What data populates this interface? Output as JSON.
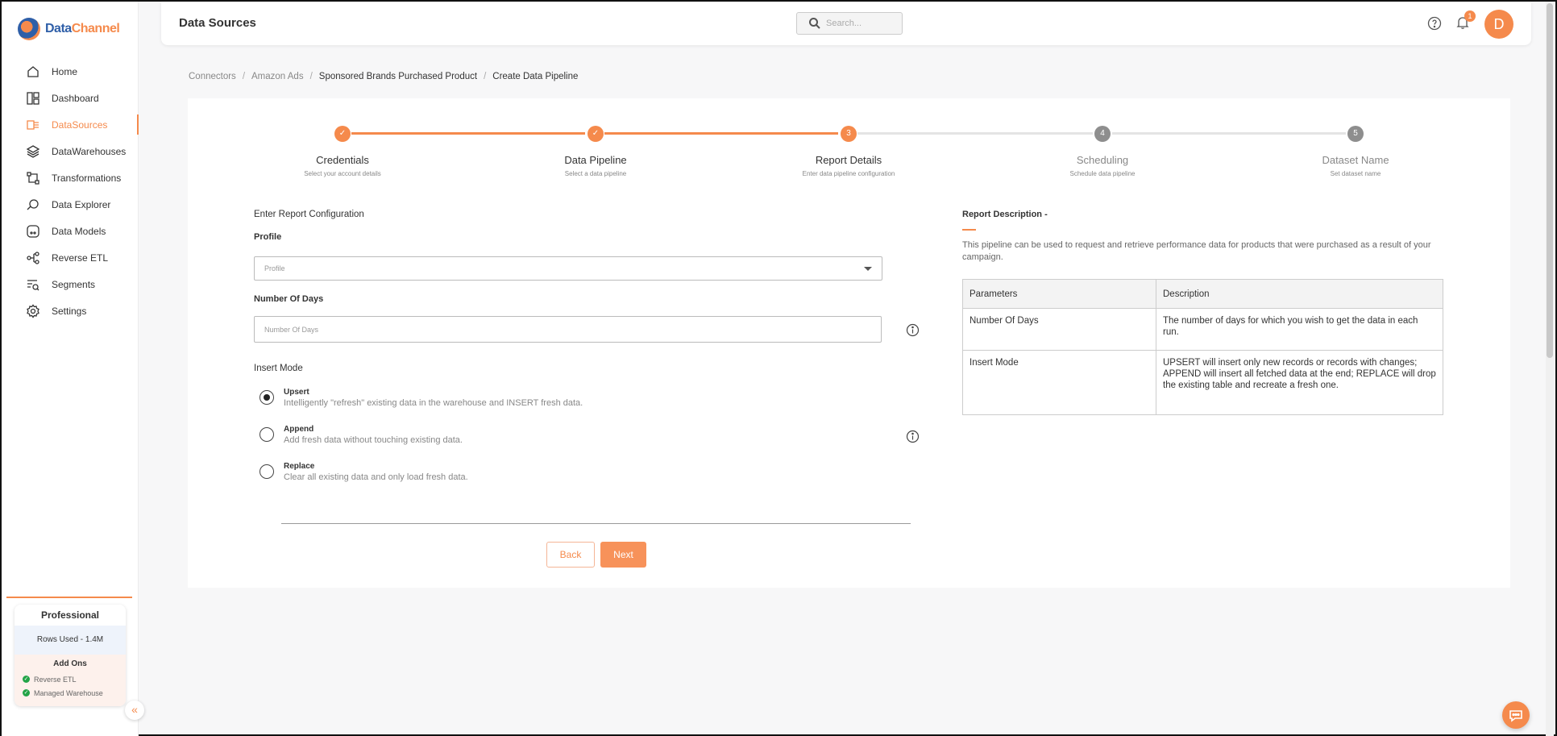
{
  "brand": {
    "name_part1": "Data",
    "name_part2": "Channel"
  },
  "colors": {
    "accent": "#f58a4c",
    "brand_blue": "#2f5fa8",
    "step_todo": "#8e8e8e",
    "success": "#22a447"
  },
  "sidebar": {
    "items": [
      {
        "label": "Home",
        "icon": "home-icon"
      },
      {
        "label": "Dashboard",
        "icon": "dashboard-icon"
      },
      {
        "label": "DataSources",
        "icon": "datasources-icon",
        "active": true
      },
      {
        "label": "DataWarehouses",
        "icon": "layers-icon"
      },
      {
        "label": "Transformations",
        "icon": "transform-icon"
      },
      {
        "label": "Data Explorer",
        "icon": "explorer-icon"
      },
      {
        "label": "Data Models",
        "icon": "models-icon"
      },
      {
        "label": "Reverse ETL",
        "icon": "reverse-etl-icon"
      },
      {
        "label": "Segments",
        "icon": "segments-icon"
      },
      {
        "label": "Settings",
        "icon": "gear-icon"
      }
    ],
    "plan": {
      "title": "Professional",
      "rows_used": "Rows Used - 1.4M",
      "addons_title": "Add Ons",
      "addons": [
        "Reverse ETL",
        "Managed Warehouse"
      ]
    }
  },
  "header": {
    "title": "Data Sources",
    "search_placeholder": "Search...",
    "notification_count": "1",
    "avatar_initial": "D"
  },
  "breadcrumb": [
    "Connectors",
    "Amazon Ads",
    "Sponsored Brands Purchased Product",
    "Create Data Pipeline"
  ],
  "stepper": [
    {
      "number": "1",
      "label": "Credentials",
      "sub": "Select your account details",
      "status": "done"
    },
    {
      "number": "2",
      "label": "Data Pipeline",
      "sub": "Select a data pipeline",
      "status": "done"
    },
    {
      "number": "3",
      "label": "Report Details",
      "sub": "Enter data pipeline configuration",
      "status": "current"
    },
    {
      "number": "4",
      "label": "Scheduling",
      "sub": "Schedule data pipeline",
      "status": "todo"
    },
    {
      "number": "5",
      "label": "Dataset Name",
      "sub": "Set dataset name",
      "status": "todo"
    }
  ],
  "form": {
    "section_title": "Enter Report Configuration",
    "profile_label": "Profile",
    "profile_placeholder": "Profile",
    "days_label": "Number Of Days",
    "days_placeholder": "Number Of Days",
    "insert_mode_label": "Insert Mode",
    "modes": [
      {
        "title": "Upsert",
        "desc": "Intelligently \"refresh\" existing data in the warehouse and INSERT fresh data.",
        "selected": true
      },
      {
        "title": "Append",
        "desc": "Add fresh data without touching existing data.",
        "selected": false
      },
      {
        "title": "Replace",
        "desc": "Clear all existing data and only load fresh data.",
        "selected": false
      }
    ],
    "back_label": "Back",
    "next_label": "Next"
  },
  "description": {
    "title": "Report Description -",
    "text": "This pipeline can be used to request and retrieve performance data for products that were purchased as a result of your campaign.",
    "table": {
      "headers": [
        "Parameters",
        "Description"
      ],
      "rows": [
        [
          "Number Of Days",
          "The number of days for which you wish to get the data in each run."
        ],
        [
          "Insert Mode",
          "UPSERT will insert only new records or records with changes; APPEND will insert all fetched data at the end; REPLACE will drop the existing table and recreate a fresh one."
        ]
      ]
    }
  }
}
